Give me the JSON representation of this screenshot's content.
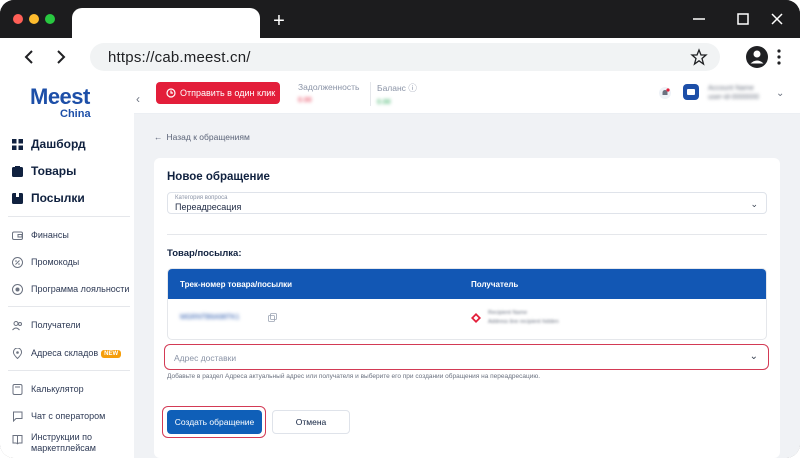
{
  "browser": {
    "url": "https://cab.meest.cn/"
  },
  "app": {
    "logo": {
      "main": "Meest",
      "sub": "China"
    },
    "sidebar": {
      "items": [
        {
          "label": "Дашборд",
          "icon": "dashboard-icon"
        },
        {
          "label": "Товары",
          "icon": "box-icon"
        },
        {
          "label": "Посылки",
          "icon": "parcel-icon"
        },
        {
          "label": "Финансы",
          "icon": "wallet-icon"
        },
        {
          "label": "Промокоды",
          "icon": "percent-icon"
        },
        {
          "label": "Программа лояльности",
          "icon": "loyalty-icon"
        },
        {
          "label": "Получатели",
          "icon": "users-icon"
        },
        {
          "label": "Адреса складов",
          "icon": "location-icon",
          "badge": "NEW"
        },
        {
          "label": "Калькулятор",
          "icon": "calculator-icon"
        },
        {
          "label": "Чат с оператором",
          "icon": "chat-icon"
        },
        {
          "label": "Инструкции по маркетплейсам",
          "icon": "book-icon"
        }
      ]
    },
    "header": {
      "send_button": "Отправить в один клик",
      "debt_label": "Задолженность",
      "debt_value": "0.00",
      "balance_label": "Баланс",
      "balance_value": "0.00",
      "account_name": "Account Name",
      "account_id": "user-id-0000000"
    },
    "content": {
      "back_link": "Назад к обращениям",
      "title": "Новое обращение",
      "category": {
        "label": "Категория вопроса",
        "value": "Переадресация"
      },
      "section_label": "Товар/посылка:",
      "table": {
        "headers": [
          "Трек-номер товара/посылки",
          "Получатель"
        ],
        "rows": [
          {
            "track": "MGRNTB6A98TK1",
            "recipient_line1": "Recipient Name",
            "recipient_line2": "Address line recipient hidden"
          }
        ]
      },
      "address_placeholder": "Адрес доставки",
      "hint": "Добавьте в раздел Адреса актуальный адрес или получателя и выберите его при создании обращения на переадресацию.",
      "submit_button": "Создать обращение",
      "cancel_button": "Отмена"
    },
    "colors": {
      "brand_blue": "#1d4fa8",
      "accent_red": "#e31e3a",
      "table_header": "#1257b4"
    }
  }
}
